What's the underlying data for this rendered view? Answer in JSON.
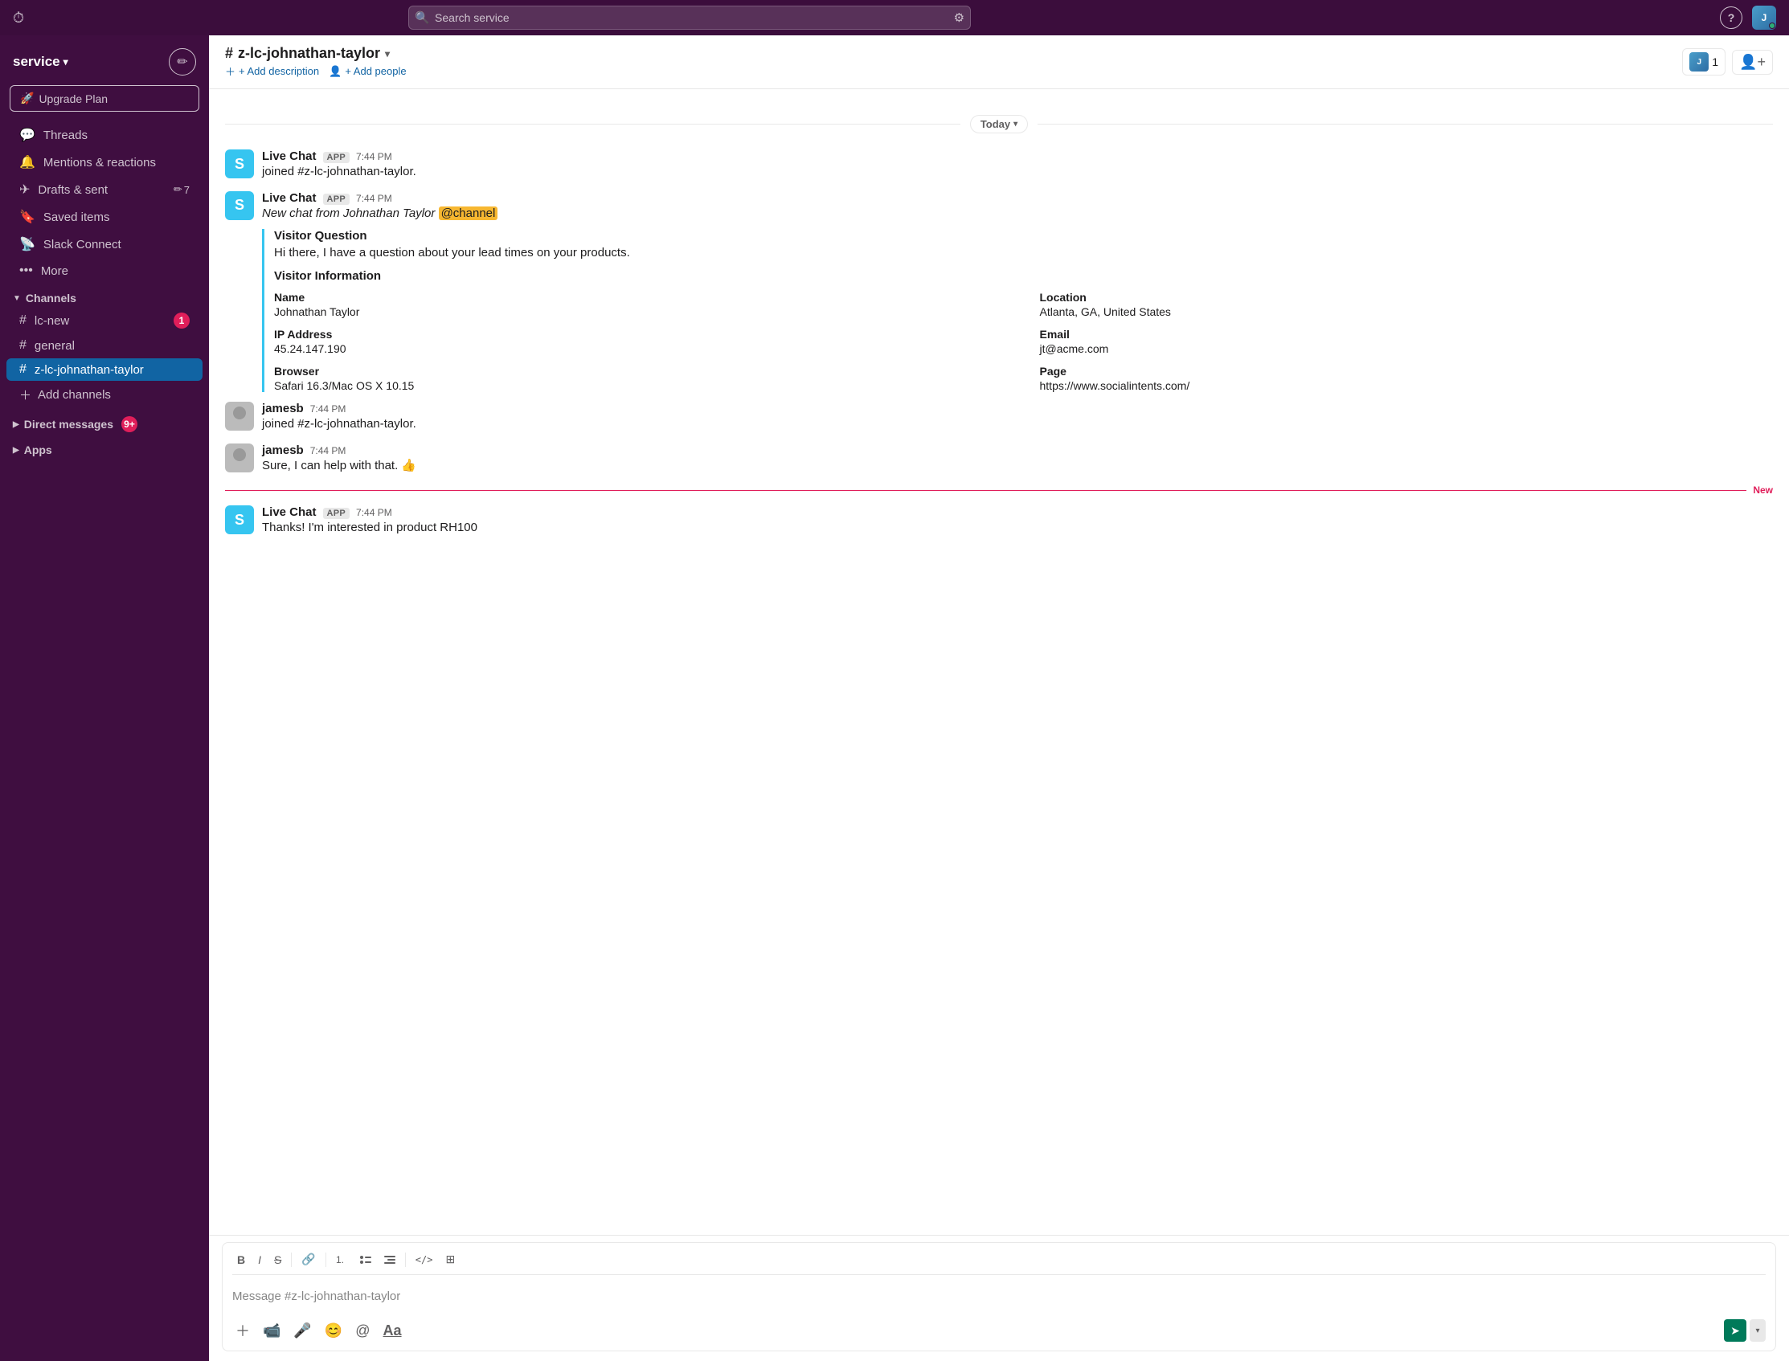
{
  "topbar": {
    "history_icon": "⏱",
    "search_placeholder": "Search service",
    "filter_icon": "⚙",
    "help_label": "?",
    "avatar_alt": "user avatar"
  },
  "sidebar": {
    "workspace_name": "service",
    "workspace_chevron": "▾",
    "compose_icon": "✏",
    "upgrade_label": "Upgrade Plan",
    "nav_items": [
      {
        "id": "threads",
        "label": "Threads",
        "icon": "💬"
      },
      {
        "id": "mentions",
        "label": "Mentions & reactions",
        "icon": "🔔"
      },
      {
        "id": "drafts",
        "label": "Drafts & sent",
        "icon": "✈",
        "count": "7"
      },
      {
        "id": "saved",
        "label": "Saved items",
        "icon": "🔖"
      },
      {
        "id": "connect",
        "label": "Slack Connect",
        "icon": "📡"
      },
      {
        "id": "more",
        "label": "More",
        "icon": "···"
      }
    ],
    "channels_section": "Channels",
    "channels": [
      {
        "id": "lc-new",
        "name": "lc-new",
        "badge": "1"
      },
      {
        "id": "general",
        "name": "general",
        "badge": null
      },
      {
        "id": "z-lc-johnathan-taylor",
        "name": "z-lc-johnathan-taylor",
        "badge": null,
        "active": true
      }
    ],
    "add_channels_label": "Add channels",
    "dm_section_label": "Direct messages",
    "dm_badge": "9+",
    "apps_section_label": "Apps"
  },
  "channel": {
    "name": "z-lc-johnathan-taylor",
    "hash": "#",
    "chevron": "▾",
    "add_description": "+ Add description",
    "add_people_label": "+ Add people",
    "member_count": "1"
  },
  "date_label": "Today",
  "messages": [
    {
      "id": "msg1",
      "author": "Live Chat",
      "app": true,
      "time": "7:44 PM",
      "text": "joined #z-lc-johnathan-taylor.",
      "avatar_type": "live_chat"
    },
    {
      "id": "msg2",
      "author": "Live Chat",
      "app": true,
      "time": "7:44 PM",
      "text_prefix": "New chat from Johnathan Taylor",
      "mention": "@channel",
      "avatar_type": "live_chat",
      "has_visitor_info": true,
      "visitor_info": {
        "title": "Visitor Question",
        "question": "Hi there, I have a question about your lead times on your products.",
        "info_title": "Visitor Information",
        "fields": [
          {
            "label": "Name",
            "value": "Johnathan Taylor"
          },
          {
            "label": "Location",
            "value": "Atlanta, GA, United States"
          },
          {
            "label": "IP Address",
            "value": "45.24.147.190"
          },
          {
            "label": "Email",
            "value": "jt@acme.com"
          },
          {
            "label": "Browser",
            "value": "Safari 16.3/Mac OS X 10.15"
          },
          {
            "label": "Page",
            "value": "https://www.socialintents.com/"
          }
        ]
      }
    },
    {
      "id": "msg3",
      "author": "jamesb",
      "app": false,
      "time": "7:44 PM",
      "text": "joined #z-lc-johnathan-taylor.",
      "avatar_type": "jamesb"
    },
    {
      "id": "msg4",
      "author": "jamesb",
      "app": false,
      "time": "7:44 PM",
      "text": "Sure, I can help with that. 👍",
      "avatar_type": "jamesb"
    },
    {
      "id": "msg5",
      "author": "Live Chat",
      "app": true,
      "time": "7:44 PM",
      "text": "Thanks!  I'm interested in product RH100",
      "avatar_type": "live_chat",
      "is_new": true
    }
  ],
  "new_label": "New",
  "input": {
    "placeholder": "Message #z-lc-johnathan-taylor",
    "toolbar": {
      "bold": "B",
      "italic": "I",
      "strike": "S",
      "link": "🔗",
      "ordered_list": "≡",
      "bullet_list": "≡",
      "indent": "⇥",
      "code": "</>",
      "more": "⊞"
    }
  }
}
